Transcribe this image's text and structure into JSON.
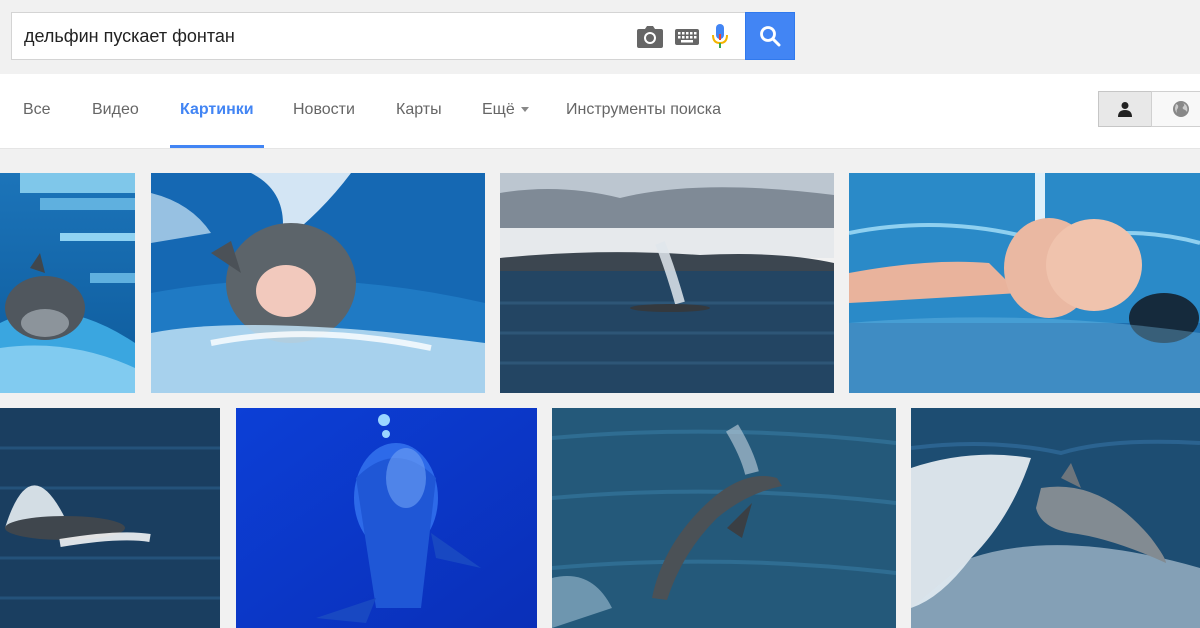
{
  "search": {
    "query": "дельфин пускает фонтан"
  },
  "tabs": [
    {
      "label": "Все"
    },
    {
      "label": "Видео"
    },
    {
      "label": "Картинки"
    },
    {
      "label": "Новости"
    },
    {
      "label": "Карты"
    },
    {
      "label": "Ещё"
    },
    {
      "label": "Инструменты поиска"
    }
  ],
  "icons": [
    "camera-icon",
    "keyboard-icon",
    "microphone-icon",
    "search-icon",
    "person-icon",
    "globe-icon",
    "chevron-down-icon"
  ],
  "colors": {
    "accent": "#4285f4",
    "page_bg": "#f1f1f1",
    "tab_text": "#666666"
  },
  "results": [
    {
      "row": 1,
      "subject": "dolphin in pool"
    },
    {
      "row": 1,
      "subject": "dolphin with open mouth and spout"
    },
    {
      "row": 1,
      "subject": "whale blow at sea"
    },
    {
      "row": 1,
      "subject": "swimmer in pool with water jet"
    },
    {
      "row": 2,
      "subject": "whale blow in ocean"
    },
    {
      "row": 2,
      "subject": "dolphin underwater blue"
    },
    {
      "row": 2,
      "subject": "dolphin swimming with spray"
    },
    {
      "row": 2,
      "subject": "dolphin jumping in wake"
    }
  ]
}
